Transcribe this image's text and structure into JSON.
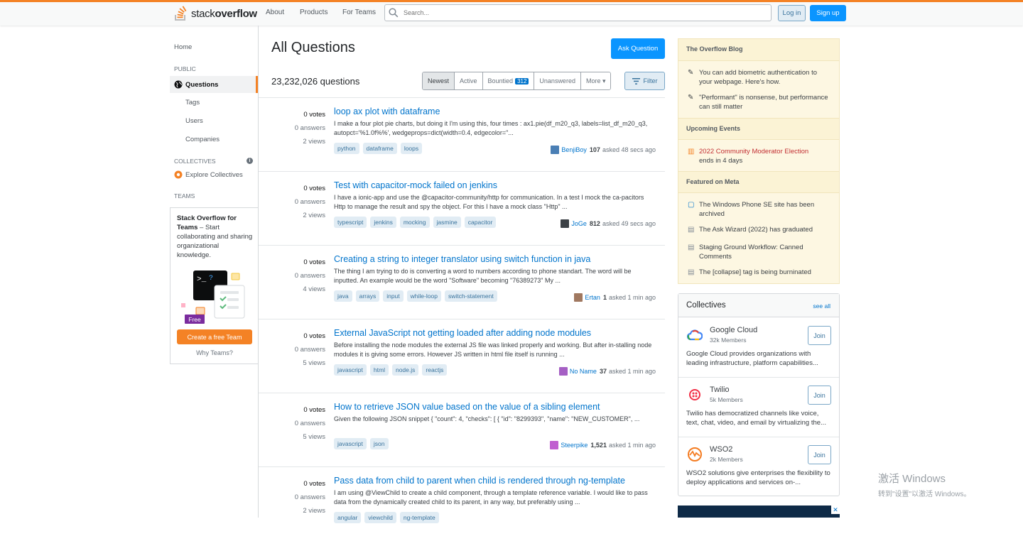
{
  "header": {
    "logo_text_light": "stack",
    "logo_text_bold": "overflow",
    "nav": [
      "About",
      "Products",
      "For Teams"
    ],
    "search_placeholder": "Search...",
    "login_label": "Log in",
    "signup_label": "Sign up"
  },
  "sidebar": {
    "home": "Home",
    "public_label": "PUBLIC",
    "questions": "Questions",
    "tags": "Tags",
    "users": "Users",
    "companies": "Companies",
    "collectives_label": "COLLECTIVES",
    "explore_collectives": "Explore Collectives",
    "teams_label": "TEAMS",
    "teams_title": "Stack Overflow for Teams",
    "teams_desc": " – Start collaborating and sharing organizational knowledge.",
    "free_badge": "Free",
    "create_team": "Create a free Team",
    "why_teams": "Why Teams?"
  },
  "main": {
    "title": "All Questions",
    "ask_button": "Ask Question",
    "count": "23,232,026 questions",
    "tabs": [
      {
        "label": "Newest",
        "active": true
      },
      {
        "label": "Active"
      },
      {
        "label": "Bountied",
        "badge": "312"
      },
      {
        "label": "Unanswered"
      },
      {
        "label": "More ▾"
      }
    ],
    "filter_label": "Filter",
    "questions": [
      {
        "votes": "0 votes",
        "answers": "0 answers",
        "views": "2 views",
        "title": "loop ax plot with dataframe",
        "excerpt": "I make a four plot pie charts, but doing it I'm using this, four times : ax1.pie(df_m20_q3, labels=list_df_m20_q3, autopct='%1.0f%%', wedgeprops=dict(width=0.4, edgecolor=\"...",
        "tags": [
          "python",
          "dataframe",
          "loops"
        ],
        "user": "BenjiBoy",
        "rep": "107",
        "time": "asked 48 secs ago",
        "avatar_color": "#4a7fb5"
      },
      {
        "votes": "0 votes",
        "answers": "0 answers",
        "views": "2 views",
        "title": "Test with capacitor-mock failed on jenkins",
        "excerpt": "I have a ionic-app and use the @capacitor-community/http for communication. In a test I mock the ca-pacitors Http to manage the result and spy the object. For this I have a mock class \"Http\" ...",
        "tags": [
          "typescript",
          "jenkins",
          "mocking",
          "jasmine",
          "capacitor"
        ],
        "user": "JoGe",
        "rep": "812",
        "time": "asked 49 secs ago",
        "avatar_color": "#3b4045"
      },
      {
        "votes": "0 votes",
        "answers": "0 answers",
        "views": "4 views",
        "title": "Creating a string to integer translator using switch function in java",
        "excerpt": "The thing I am trying to do is converting a word to numbers according to phone standart. The word will be inputted. An example would be the word \"Software\" becoming \"76389273\" My ...",
        "tags": [
          "java",
          "arrays",
          "input",
          "while-loop",
          "switch-statement"
        ],
        "user": "Ertan",
        "rep": "1",
        "time": "asked 1 min ago",
        "avatar_color": "#a07860"
      },
      {
        "votes": "0 votes",
        "answers": "0 answers",
        "views": "5 views",
        "title": "External JavaScript not getting loaded after adding node modules",
        "excerpt": "Before installing the node modules the external JS file was linked properly and working. But after in-stalling node modules it is giving some errors. However JS written in html file itself is running ...",
        "tags": [
          "javascript",
          "html",
          "node.js",
          "reactjs"
        ],
        "user": "No Name",
        "rep": "37",
        "time": "asked 1 min ago",
        "avatar_color": "#a55fc4"
      },
      {
        "votes": "0 votes",
        "answers": "0 answers",
        "views": "5 views",
        "title": "How to retrieve JSON value based on the value of a sibling element",
        "excerpt": "Given the following JSON snippet { \"count\": 4, \"checks\": [ { \"id\": \"8299393\", \"name\": \"NEW_CUSTOMER\", ...",
        "tags": [
          "javascript",
          "json"
        ],
        "user": "Steerpike",
        "rep": "1,521",
        "time": "asked 1 min ago",
        "avatar_color": "#c05fd0"
      },
      {
        "votes": "0 votes",
        "answers": "0 answers",
        "views": "2 views",
        "title": "Pass data from child to parent when child is rendered through ng-template",
        "excerpt": "I am using @ViewChild to create a child component, through a template reference variable. I would like to pass data from the dynamically created child to its parent, in any way, but preferably using ...",
        "tags": [
          "angular",
          "viewchild",
          "ng-template"
        ],
        "user": "",
        "rep": "",
        "time": "",
        "avatar_color": "#ffffff"
      }
    ]
  },
  "blog": {
    "heading": "The Overflow Blog",
    "items": [
      "You can add biometric authentication to your webpage. Here's how.",
      "\"Performant\" is nonsense, but performance can still matter"
    ],
    "events_heading": "Upcoming Events",
    "event_title": "2022 Community Moderator Election",
    "event_sub": "ends in 4 days",
    "meta_heading": "Featured on Meta",
    "meta_items": [
      "The Windows Phone SE site has been archived",
      "The Ask Wizard (2022) has graduated",
      "Staging Ground Workflow: Canned Comments",
      "The [collapse] tag is being burninated"
    ]
  },
  "collectives": {
    "heading": "Collectives",
    "see_all": "see all",
    "join_label": "Join",
    "items": [
      {
        "name": "Google Cloud",
        "members": "32k Members",
        "desc": "Google Cloud provides organizations with leading infrastructure, platform capabilities..."
      },
      {
        "name": "Twilio",
        "members": "5k Members",
        "desc": "Twilio has democratized channels like voice, text, chat, video, and email by virtualizing the..."
      },
      {
        "name": "WSO2",
        "members": "2k Members",
        "desc": "WSO2 solutions give enterprises the flexibility to deploy applications and services on-..."
      }
    ]
  },
  "watermark": {
    "line1": "激活 Windows",
    "line2": "转到\"设置\"以激活 Windows。"
  },
  "colors": {
    "accent": "#f48225",
    "link": "#0074cc",
    "primary_button": "#0a95ff"
  }
}
